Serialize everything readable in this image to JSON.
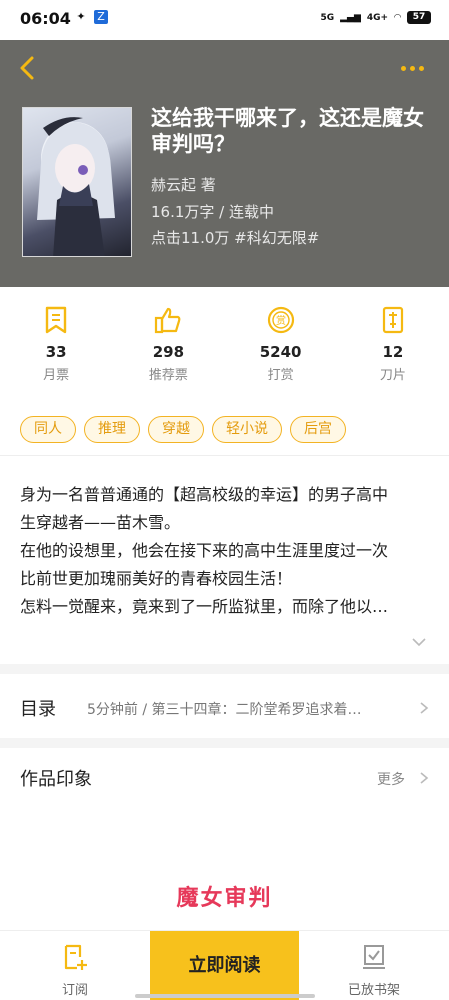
{
  "status_bar": {
    "time": "06:04",
    "network_label": "5G",
    "network2_label": "4G+",
    "battery": "57"
  },
  "book": {
    "title": "这给我干哪来了，这还是魔女审判吗？",
    "author": "赫云起  著",
    "stats_line": "16.1万字 / 连载中",
    "clicks_line": "点击11.0万  #科幻无限#"
  },
  "stats": [
    {
      "icon": "monthly-ticket-icon",
      "value": "33",
      "label": "月票"
    },
    {
      "icon": "thumbs-up-icon",
      "value": "298",
      "label": "推荐票"
    },
    {
      "icon": "reward-coin-icon",
      "value": "5240",
      "label": "打赏"
    },
    {
      "icon": "blade-icon",
      "value": "12",
      "label": "刀片"
    }
  ],
  "tags": [
    "同人",
    "推理",
    "穿越",
    "轻小说",
    "后宫"
  ],
  "intro": [
    "身为一名普普通通的【超高校级的幸运】的男子高中",
    "生穿越者——苗木雪。",
    "在他的设想里，他会在接下来的高中生涯里度过一次",
    "比前世更加瑰丽美好的青春校园生活！",
    "怎料一觉醒来，竟来到了一所监狱里，而除了他以…"
  ],
  "toc": {
    "label": "目录",
    "latest": "5分钟前 / 第三十四章：二阶堂希罗追求着…"
  },
  "impression": {
    "label": "作品印象",
    "more": "更多",
    "text": "魔女审判"
  },
  "bottom_bar": {
    "subscribe": "订阅",
    "read_now": "立即阅读",
    "shelf": "已放书架"
  },
  "colors": {
    "accent": "#f7c11c",
    "header_bg": "#696965",
    "tag_text": "#e49c0e",
    "impression": "#e6395a"
  }
}
